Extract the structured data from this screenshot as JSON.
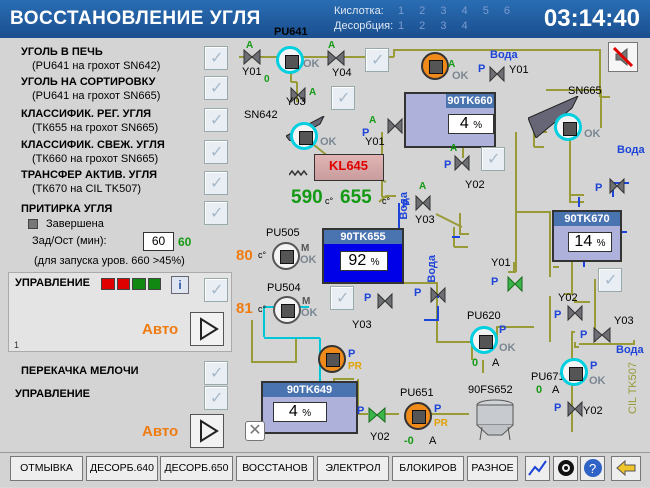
{
  "header": {
    "title": "ВОССТАНОВЛЕНИЕ УГЛЯ",
    "acid_label": "Кислотка:",
    "desorb_label": "Десорбция:",
    "acid_numbers": "1 2 3 4 5 6",
    "desorb_numbers": "1 2 3 4",
    "time": "03:14:40"
  },
  "left": {
    "rows": [
      {
        "title": "УГОЛЬ В ПЕЧЬ",
        "subtitle": "(PU641 на грохот SN642)"
      },
      {
        "title": "УГОЛЬ НА СОРТИРОВКУ",
        "subtitle": "(PU641 на грохот SN665)"
      },
      {
        "title": "КЛАССИФИК. РЕГ. УГЛЯ",
        "subtitle": "(ТК655 на грохот SN665)"
      },
      {
        "title": "КЛАССИФИК. СВЕЖ. УГЛЯ",
        "subtitle": "(ТК660 на грохот SN665)"
      },
      {
        "title": "ТРАНСФЕР АКТИВ. УГЛЯ",
        "subtitle": "(ТК670 на CIL TK507)"
      }
    ],
    "pritirka_title": "ПРИТИРКА УГЛЯ",
    "completed_label": "Завершена",
    "zad_label": "Зад/Ост (мин):",
    "zad_value": "60",
    "zad_current": "60",
    "launch_note": "(для запуска уров.  660 >45%)",
    "control_label": "УПРАВЛЕНИЕ",
    "auto_label": "Авто",
    "step_number": "1",
    "perekachka_label": "ПЕРЕКАЧКА МЕЛОЧИ",
    "control2_label": "УПРАВЛЕНИЕ",
    "auto2_label": "Авто"
  },
  "schema": {
    "pu641": "PU641",
    "y01a": "Y01",
    "y04": "Y04",
    "y03a": "Y03",
    "sn642": "SN642",
    "tk660": {
      "name": "90TK660",
      "value": "4",
      "unit": "%"
    },
    "vodaTop": "Вода",
    "y01b": "Y01",
    "sn665": "SN665",
    "y01c": "Y01",
    "y02a": "Y02",
    "kl645": "KL645",
    "temp1": "590",
    "temp2": "655",
    "deg": "c°",
    "voda_vertical": "Вода",
    "tk655": {
      "name": "90TK655",
      "value": "92",
      "unit": "%"
    },
    "y03b": "Y03",
    "voda_right": "Вода",
    "tk670": {
      "name": "90TK670",
      "value": "14",
      "unit": "%"
    },
    "pu505": "PU505",
    "temp80": "80",
    "pu504": "PU504",
    "temp81": "81",
    "y03c": "Y03",
    "y01d": "Y01",
    "voda_mid": "Вода",
    "pu620": "PU620",
    "zero": "0",
    "A": "A",
    "y02b": "Y02",
    "y03d": "Y03",
    "voda_bottom": "Вода",
    "tk649": {
      "name": "90TK649",
      "value": "4",
      "unit": "%"
    },
    "pu651": "PU651",
    "fs652": "90FS652",
    "pu671": "PU671",
    "pu671_val": "0",
    "y02c": "Y02",
    "y02d": "Y02",
    "cil": "CIL TK507",
    "ok": "OK",
    "M": "M",
    "P": "P",
    "PR": "PR",
    "minus0": "-0"
  },
  "toolbar": [
    "ОТМЫВКА",
    "ДЕСОРБ.640",
    "ДЕСОРБ.650",
    "ВОССТАНОВ",
    "ЭЛЕКТРОЛ",
    "БЛОКИРОВ",
    "РАЗНОЕ"
  ]
}
